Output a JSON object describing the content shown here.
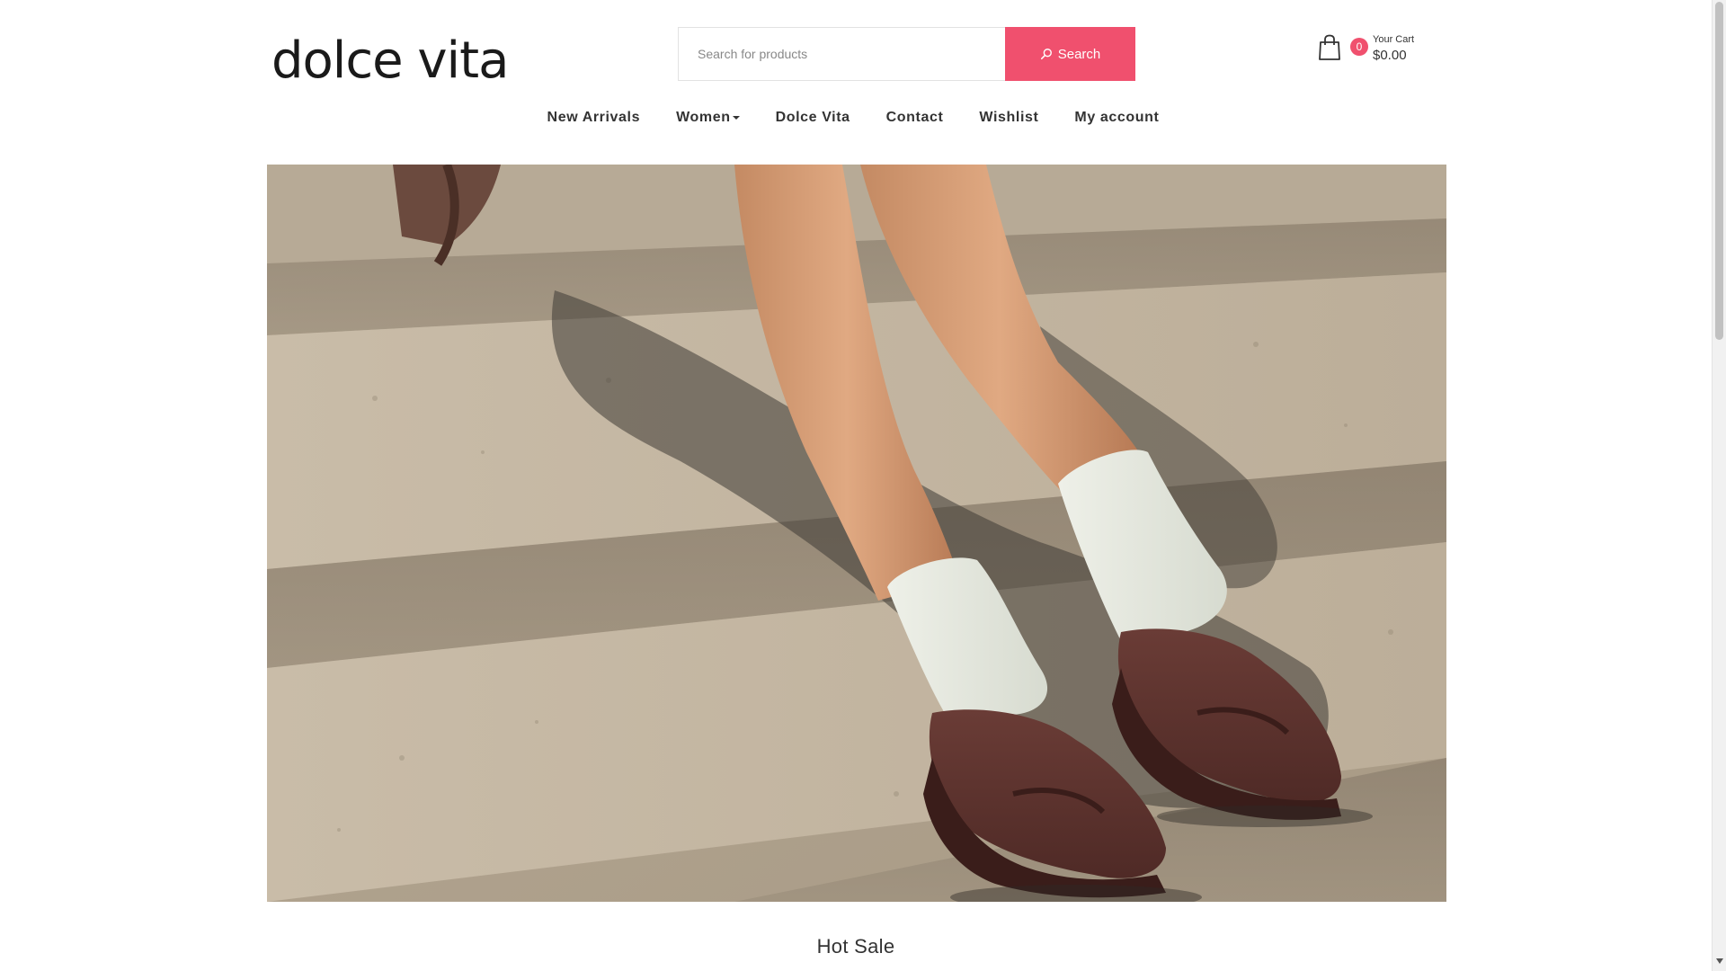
{
  "brand": {
    "logo_text": "dolce vita"
  },
  "search": {
    "placeholder": "Search for products",
    "button_label": "Search",
    "value": ""
  },
  "cart": {
    "count": "0",
    "label": "Your Cart",
    "total": "$0.00"
  },
  "nav": {
    "items": [
      {
        "label": "New Arrivals",
        "has_dropdown": false
      },
      {
        "label": "Women",
        "has_dropdown": true
      },
      {
        "label": "Dolce Vita",
        "has_dropdown": false
      },
      {
        "label": "Contact",
        "has_dropdown": false
      },
      {
        "label": "Wishlist",
        "has_dropdown": false
      },
      {
        "label": "My account",
        "has_dropdown": false
      }
    ]
  },
  "hero": {
    "image": "legs-in-white-socks-and-brown-suede-loafers-on-stone-steps"
  },
  "sections": {
    "hot_sale_title": "Hot Sale"
  },
  "colors": {
    "accent": "#f0506e",
    "text": "#333333",
    "background": "#ffffff"
  },
  "icons": {
    "cart": "shopping-bag-icon",
    "search": "search-icon",
    "dropdown": "caret-down-icon"
  }
}
